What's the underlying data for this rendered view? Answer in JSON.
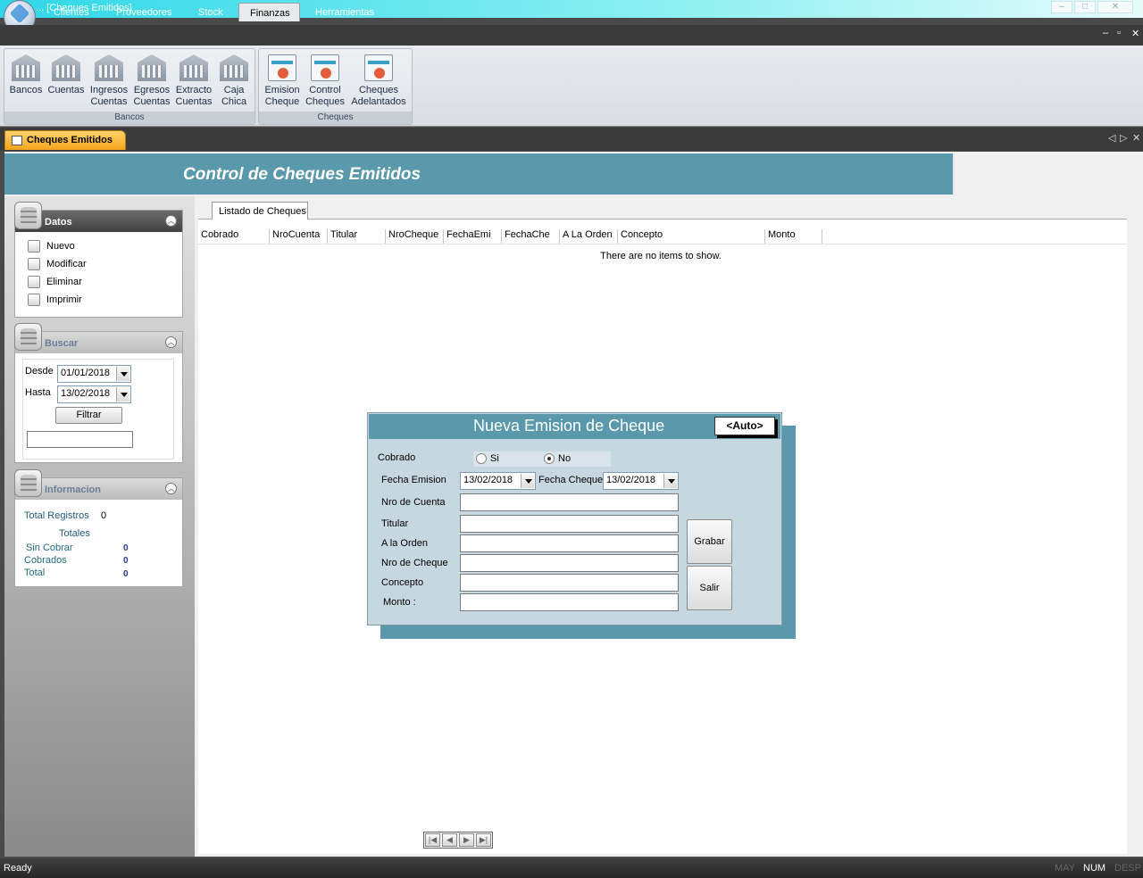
{
  "window": {
    "title": "... [Cheques Emitidos]",
    "controls": [
      "–",
      "□",
      "✕"
    ]
  },
  "menu": {
    "tabs": [
      "Clientes",
      "Proveedores",
      "Stock",
      "Finanzas",
      "Herramientas"
    ],
    "active": "Finanzas",
    "mdi_controls": [
      "–",
      "▫",
      "✕"
    ]
  },
  "ribbon": {
    "groups": [
      {
        "label": "Bancos",
        "buttons": [
          {
            "line1": "Bancos",
            "line2": ""
          },
          {
            "line1": "Cuentas",
            "line2": ""
          },
          {
            "line1": "Ingresos",
            "line2": "Cuentas"
          },
          {
            "line1": "Egresos",
            "line2": "Cuentas"
          },
          {
            "line1": "Extracto",
            "line2": "Cuentas"
          },
          {
            "line1": "Caja",
            "line2": "Chica"
          }
        ]
      },
      {
        "label": "Cheques",
        "buttons": [
          {
            "line1": "Emision",
            "line2": "Cheque"
          },
          {
            "line1": "Control",
            "line2": "Cheques"
          },
          {
            "line1": "Cheques",
            "line2": "Adelantados"
          }
        ]
      }
    ]
  },
  "doc_tab": {
    "label": "Cheques Emitidos",
    "controls": [
      "◁",
      "▷",
      "✕"
    ]
  },
  "banner": {
    "title": "Control de Cheques Emitidos"
  },
  "datos": {
    "title": "Datos",
    "tasks": [
      "Nuevo",
      "Modificar",
      "Eliminar",
      "Imprimir"
    ]
  },
  "buscar": {
    "title": "Buscar",
    "desde_label": "Desde",
    "desde_value": "01/01/2018",
    "hasta_label": "Hasta",
    "hasta_value": "13/02/2018",
    "filtrar_label": "Filtrar",
    "search_value": ""
  },
  "informacion": {
    "title": "Informacion",
    "total_registros_label": "Total Registros",
    "total_registros_value": "0",
    "totales_label": "Totales",
    "rows": [
      {
        "label": "Sin Cobrar",
        "value": "0"
      },
      {
        "label": "Cobrados",
        "value": "0"
      },
      {
        "label": "Total",
        "value": "0"
      }
    ]
  },
  "list": {
    "tab_label": "Listado de Cheques",
    "columns": [
      "Cobrado",
      "NroCuenta",
      "Titular",
      "NroCheque",
      "FechaEmi",
      "FechaChe",
      "A La Orden",
      "Concepto",
      "Monto"
    ],
    "empty_text": "There are no items to show.",
    "pager": [
      "|◀",
      "◀",
      "▶",
      "▶|"
    ]
  },
  "dialog": {
    "title": "Nueva Emision de Cheque",
    "auto_label": "<Auto>",
    "cobrado_label": "Cobrado",
    "radio_si": "Si",
    "radio_no": "No",
    "cobrado_selected": "No",
    "fecha_emision_label": "Fecha Emision",
    "fecha_emision_value": "13/02/2018",
    "fecha_cheque_label": "Fecha Cheque",
    "fecha_cheque_value": "13/02/2018",
    "fields": [
      {
        "label": "Nro de Cuenta",
        "value": ""
      },
      {
        "label": "Titular",
        "value": ""
      },
      {
        "label": "A la Orden",
        "value": ""
      },
      {
        "label": "Nro de Cheque",
        "value": ""
      },
      {
        "label": "Concepto",
        "value": ""
      },
      {
        "label": "Monto :",
        "value": ""
      }
    ],
    "grabar_label": "Grabar",
    "salir_label": "Salir"
  },
  "status": {
    "ready": "Ready",
    "indicators": [
      "MAY",
      "NUM",
      "DESP"
    ]
  },
  "colors": {
    "accent": "#5a99ab",
    "tab_active": "#f3a51c",
    "dialog_bg": "#c7d7e0"
  }
}
